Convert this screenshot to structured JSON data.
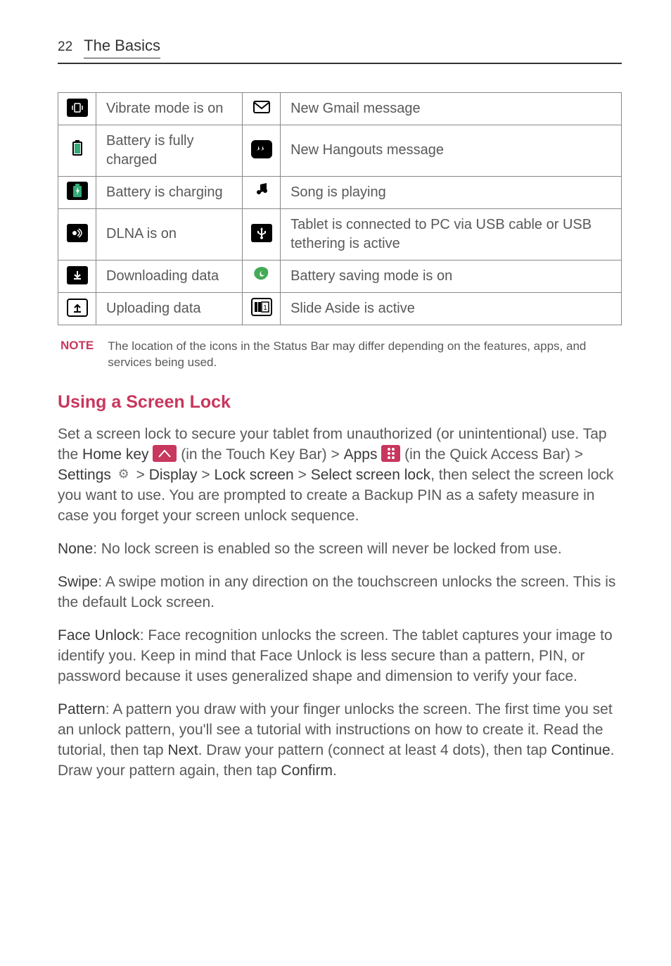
{
  "header": {
    "page_number": "22",
    "chapter": "The Basics"
  },
  "icons_table": {
    "rows": [
      {
        "left_icon": "vibrate-icon",
        "left_text": "Vibrate mode is on",
        "right_icon": "gmail-icon",
        "right_text": "New Gmail message"
      },
      {
        "left_icon": "battery-full-icon",
        "left_text": "Battery is fully charged",
        "right_icon": "hangouts-icon",
        "right_text": "New Hangouts message"
      },
      {
        "left_icon": "battery-charging-icon",
        "left_text": "Battery is charging",
        "right_icon": "music-icon",
        "right_text": "Song is playing"
      },
      {
        "left_icon": "dlna-icon",
        "left_text": "DLNA is on",
        "right_icon": "usb-icon",
        "right_text": "Tablet is connected to PC via USB cable or USB tethering is active"
      },
      {
        "left_icon": "download-icon",
        "left_text": "Downloading data",
        "right_icon": "battery-save-icon",
        "right_text": "Battery saving mode is on"
      },
      {
        "left_icon": "upload-icon",
        "left_text": "Uploading data",
        "right_icon": "slide-aside-icon",
        "right_text": "Slide Aside is active"
      }
    ]
  },
  "note": {
    "label": "NOTE",
    "text": "The location of the icons in the Status Bar may differ depending on the features, apps, and services being used."
  },
  "section_title": "Using a Screen Lock",
  "intro": {
    "part1": "Set a screen lock to secure your tablet from unauthorized (or unintentional) use. Tap the ",
    "home_key": "Home key",
    "part2": " (in the Touch Key Bar) > ",
    "apps": "Apps",
    "part3": " (in the Quick Access Bar) > ",
    "settings": "Settings",
    "part4": " > ",
    "display": "Display",
    "part5": " > ",
    "lock_screen": "Lock screen",
    "part6": " > ",
    "select_screen_lock": "Select screen lock",
    "part7": ", then select the screen lock you want to use. You are prompted to create a Backup PIN as a safety measure in case you forget your screen unlock sequence."
  },
  "options": {
    "none": {
      "label": "None",
      "text": ": No lock screen is enabled so the screen will never be locked from use."
    },
    "swipe": {
      "label": "Swipe",
      "text": ": A swipe motion in any direction on the touchscreen unlocks the screen. This is the default Lock screen."
    },
    "face": {
      "label": "Face Unlock",
      "text": ": Face recognition unlocks the screen. The tablet captures your image to identify you. Keep in mind that Face Unlock is less secure than a pattern, PIN, or password because it uses generalized shape and dimension to verify your face."
    },
    "pattern": {
      "label": "Pattern",
      "t1": ": A pattern you draw with your finger unlocks the screen. The first time you set an unlock pattern, you'll see a tutorial with instructions on how to create it. Read the tutorial, then tap ",
      "next": "Next",
      "t2": ". Draw your pattern (connect at least 4 dots), then tap ",
      "continue": "Continue",
      "t3": ". Draw your pattern again, then tap ",
      "confirm": "Confirm",
      "t4": "."
    }
  }
}
